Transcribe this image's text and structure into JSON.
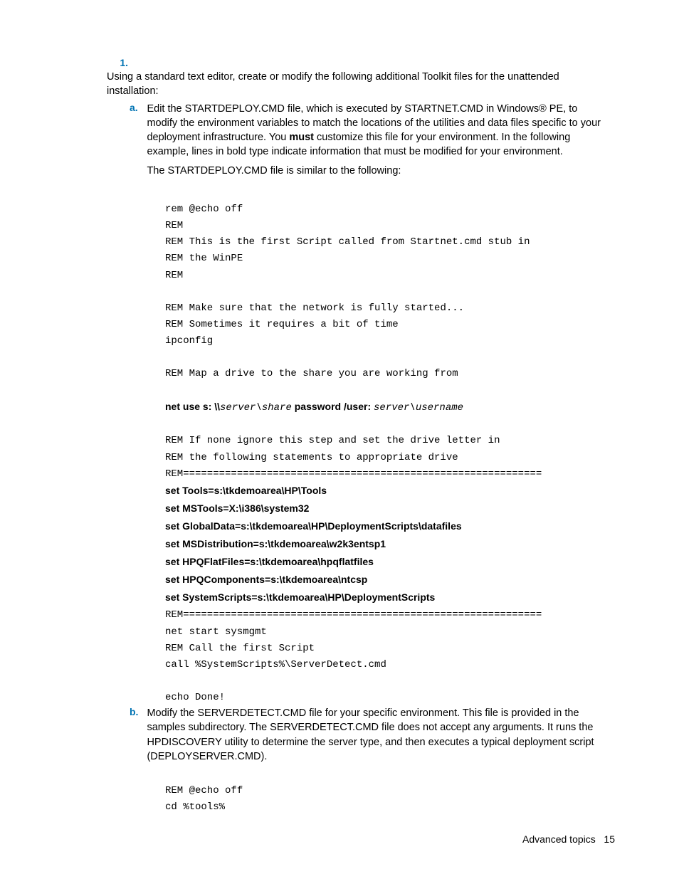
{
  "list": {
    "item1": {
      "marker": "1.",
      "text": "Using a standard text editor, create or modify the following additional Toolkit files for the unattended installation:",
      "sub_a": {
        "marker": "a.",
        "para1_pre": "Edit the STARTDEPLOY.CMD file, which is executed by STARTNET.CMD in Windows® PE, to modify the environment variables to match the locations of the utilities and data files specific to your deployment infrastructure. You ",
        "para1_bold": "must",
        "para1_post": " customize this file for your environment. In the following example, lines in bold type indicate information that must be modified for your environment.",
        "para2": "The STARTDEPLOY.CMD file is similar to the following:"
      },
      "sub_b": {
        "marker": "b.",
        "text": "Modify the SERVERDETECT.CMD file for your specific environment. This file is provided in the samples subdirectory. The SERVERDETECT.CMD file does not accept any arguments. It runs the HPDISCOVERY utility to determine the server type, and then executes a typical deployment script (DEPLOYSERVER.CMD)."
      }
    }
  },
  "code_a": {
    "l1": "rem @echo off",
    "l2": "REM",
    "l3": "REM This is the first Script called from Startnet.cmd stub in",
    "l4": "REM the WinPE",
    "l5": "REM",
    "blank1": "",
    "l6": "REM Make sure that the network is fully started...",
    "l7": "REM Sometimes it requires a bit of time",
    "l8": "ipconfig",
    "blank2": "",
    "l9": "REM Map a drive to the share you are working from",
    "blank3": "",
    "netuse_b1": "net use s: \\\\",
    "netuse_i1": "server\\share",
    "netuse_b2": " password /user: ",
    "netuse_i2": "server\\username",
    "blank4": "",
    "l10": "REM If none ignore this step and set the drive letter in",
    "l11": "REM the following statements to appropriate drive",
    "l12": "REM============================================================",
    "set1": "set Tools=s:\\tkdemoarea\\HP\\Tools",
    "set2": "set MSTools=X:\\i386\\system32",
    "set3": "set GlobalData=s:\\tkdemoarea\\HP\\DeploymentScripts\\datafiles",
    "set4": "set MSDistribution=s:\\tkdemoarea\\w2k3entsp1",
    "set5": "set HPQFlatFiles=s:\\tkdemoarea\\hpqflatfiles",
    "set6": "set HPQComponents=s:\\tkdemoarea\\ntcsp",
    "set7": "set SystemScripts=s:\\tkdemoarea\\HP\\DeploymentScripts",
    "l13": "REM============================================================",
    "l14": "net start sysmgmt",
    "l15": "REM Call the first Script",
    "l16": "call %SystemScripts%\\ServerDetect.cmd",
    "blank5": "",
    "l17": "echo Done!"
  },
  "code_b": {
    "l1": "REM @echo off",
    "l2": "cd %tools%"
  },
  "footer": {
    "section": "Advanced topics",
    "page": "15"
  }
}
